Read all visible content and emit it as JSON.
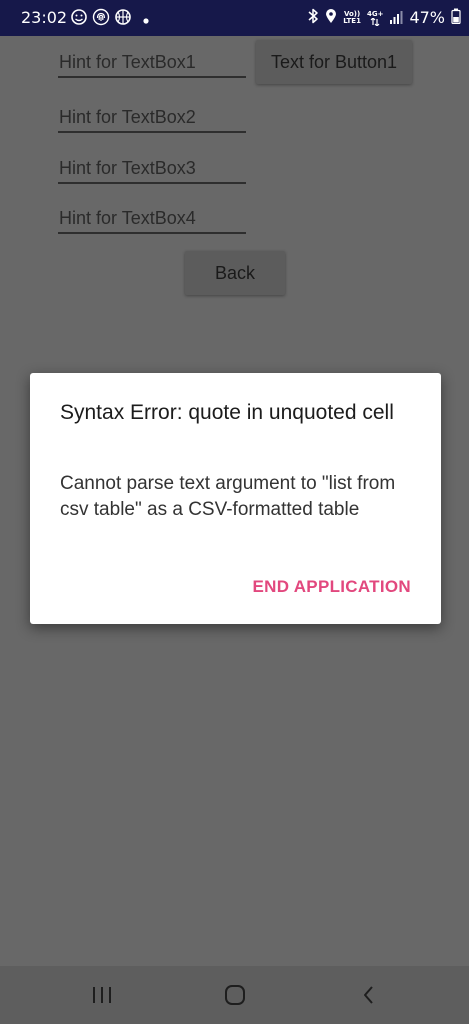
{
  "status_bar": {
    "time": "23:02",
    "network_top": "4G+",
    "volte_top": "Vo))",
    "volte_bottom": "LTE1",
    "battery": "47%",
    "left_icons": [
      "smiley-icon",
      "fingerprint-icon",
      "basketball-icon",
      "dot-icon"
    ],
    "right_icons": [
      "bluetooth-icon",
      "location-icon",
      "volte-icon",
      "network-icon",
      "signal-icon"
    ]
  },
  "app": {
    "textbox1_hint": "Hint for TextBox1",
    "textbox2_hint": "Hint for TextBox2",
    "textbox3_hint": "Hint for TextBox3",
    "textbox4_hint": "Hint for TextBox4",
    "button1_label": "Text for Button1",
    "back_label": "Back"
  },
  "dialog": {
    "title": "Syntax Error: quote in unquoted cell",
    "message": "Cannot parse text argument to \"list from csv table\" as a CSV-formatted table",
    "action_label": "END APPLICATION"
  },
  "nav_bar": {
    "icons": [
      "recents-icon",
      "home-icon",
      "back-icon"
    ]
  },
  "colors": {
    "status_bar_bg": "#16184a",
    "scrim": "#686868",
    "dialog_bg": "#ffffff",
    "accent": "#e2487e"
  }
}
